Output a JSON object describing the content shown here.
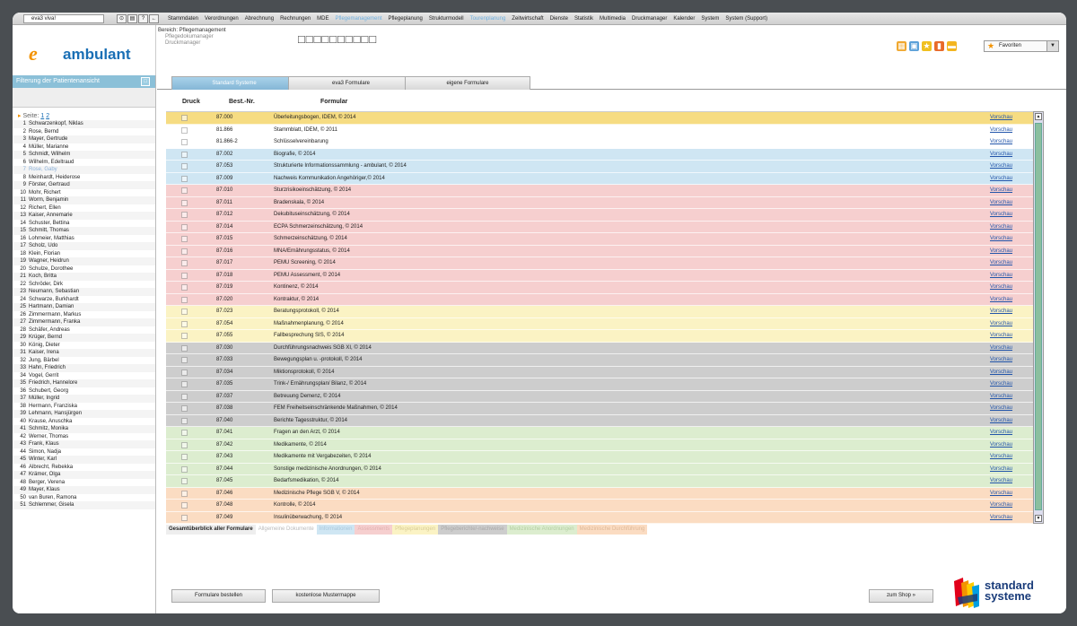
{
  "menubar": {
    "app_select": "eva3 viva!",
    "items": [
      "Stammdaten",
      "Verordnungen",
      "Abrechnung",
      "Rechnungen",
      "MDE",
      "Pflegemanagement",
      "Pflegeplanung",
      "Strukturmodell",
      "Tourenplanung",
      "Zeitwirtschaft",
      "Dienste",
      "Statistik",
      "Multimedia",
      "Druckmanager",
      "Kalender",
      "System",
      "System (Support)"
    ],
    "active_items": [
      5,
      8
    ]
  },
  "logo": {
    "mark": "e",
    "text": "ambulant"
  },
  "bereich": {
    "label": "Bereich: Pflegemanagement",
    "sub1": "Pflegedokumanager",
    "sub2": "Druckmanager"
  },
  "patient_placeholder": "□□□□□□□□□□",
  "favorites": {
    "label": "Favoriten"
  },
  "sidebar": {
    "filter_title": "Filterung der Patientenansicht",
    "seite_label": "Seite:",
    "pages": [
      "1",
      "2"
    ],
    "patients": [
      "Schwarzenkopf, Niklas",
      "Rose, Bernd",
      "Mayer, Gertrude",
      "Müller, Marianne",
      "Schmidt, Wilhelm",
      "Wilhelm, Edeltraud",
      "Rose, Gaby",
      "Meinhardt, Heiderose",
      "Förster, Gertraud",
      "Mohr, Richert",
      "Worm, Benjamin",
      "Richert, Ellen",
      "Kaiser, Annemarie",
      "Schuster, Bettina",
      "Schmitt, Thomas",
      "Lohmeier, Matthias",
      "Scholz, Udo",
      "Klein, Florian",
      "Wagner, Heidrun",
      "Schulze, Dorothee",
      "Koch, Britta",
      "Schröder, Dirk",
      "Neumann, Sebastian",
      "Schwarze, Burkhardt",
      "Hartmann, Damian",
      "Zimmermann, Markus",
      "Zimmermann, Franka",
      "Schäfer, Andreas",
      "Krüger, Bernd",
      "König, Dieter",
      "Kaiser, Irena",
      "Jung, Bärbel",
      "Hahn, Friedrich",
      "Vogel, Gerrit",
      "Friedrich, Hannelore",
      "Schubert, Georg",
      "Müller, Ingrid",
      "Hermann, Franziska",
      "Lehmann, Hansjürgen",
      "Krause, Anuschka",
      "Schmitz, Monika",
      "Werner, Thomas",
      "Frank, Klaus",
      "Simon, Nadja",
      "Winter, Karl",
      "Albrecht, Rebekka",
      "Krämer, Olga",
      "Berger, Verena",
      "Mayer, Klaus",
      "van Buren, Ramona",
      "Schlemmer, Gisela"
    ],
    "selected_index": 6
  },
  "tabs": [
    "Standard Systeme",
    "eva3 Formulare",
    "eigene Formulare"
  ],
  "table": {
    "headers": {
      "druck": "Druck",
      "nr": "Best.-Nr.",
      "formular": "Formular"
    },
    "link_label": "Vorschau",
    "rows": [
      {
        "nr": "87.000",
        "title": "Überleitungsbogen, IDEM, © 2014",
        "color": "#f6dc82"
      },
      {
        "nr": "81.866",
        "title": "Stammblatt, IDEM, © 2011",
        "color": "#ffffff"
      },
      {
        "nr": "81.866-2",
        "title": "Schlüsselvereinbarung",
        "color": "#ffffff"
      },
      {
        "nr": "87.002",
        "title": "Biografie, © 2014",
        "color": "#cfe6f3"
      },
      {
        "nr": "87.053",
        "title": "Strukturierte Informationssammlung - ambulant, © 2014",
        "color": "#cfe6f3"
      },
      {
        "nr": "87.009",
        "title": "Nachweis Kommunikation Angehöriger,© 2014",
        "color": "#cfe6f3"
      },
      {
        "nr": "87.010",
        "title": "Sturzrisikoeinschätzung, © 2014",
        "color": "#f6cfcf"
      },
      {
        "nr": "87.011",
        "title": "Bradenskala, © 2014",
        "color": "#f6cfcf"
      },
      {
        "nr": "87.012",
        "title": "Dekubituseinschätzung, © 2014",
        "color": "#f6cfcf"
      },
      {
        "nr": "87.014",
        "title": "ECPA Schmerzeinschätzung, © 2014",
        "color": "#f6cfcf"
      },
      {
        "nr": "87.015",
        "title": "Schmerzeinschätzung, © 2014",
        "color": "#f6cfcf"
      },
      {
        "nr": "87.016",
        "title": "MNA/Ernährungsstatus, © 2014",
        "color": "#f6cfcf"
      },
      {
        "nr": "87.017",
        "title": "PEMU Screening, © 2014",
        "color": "#f6cfcf"
      },
      {
        "nr": "87.018",
        "title": "PEMU Assessment, © 2014",
        "color": "#f6cfcf"
      },
      {
        "nr": "87.019",
        "title": "Kontinenz, © 2014",
        "color": "#f6cfcf"
      },
      {
        "nr": "87.020",
        "title": "Kontraktur, © 2014",
        "color": "#f6cfcf"
      },
      {
        "nr": "87.023",
        "title": "Beratungsprotokoll, © 2014",
        "color": "#fbf3c4"
      },
      {
        "nr": "87.054",
        "title": "Maßnahmenplanung, © 2014",
        "color": "#fbf3c4"
      },
      {
        "nr": "87.055",
        "title": "Fallbesprechung SIS, © 2014",
        "color": "#fbf3c4"
      },
      {
        "nr": "87.030",
        "title": "Durchführungsnachweis SGB XI, © 2014",
        "color": "#cdcdcd"
      },
      {
        "nr": "87.033",
        "title": "Bewegungsplan u. -protokoll, © 2014",
        "color": "#cdcdcd"
      },
      {
        "nr": "87.034",
        "title": "Miktionsprotokoll, © 2014",
        "color": "#cdcdcd"
      },
      {
        "nr": "87.035",
        "title": "Trink-/ Ernährungsplan/ Bilanz, © 2014",
        "color": "#cdcdcd"
      },
      {
        "nr": "87.037",
        "title": "Betreuung Demenz, © 2014",
        "color": "#cdcdcd"
      },
      {
        "nr": "87.038",
        "title": "FEM Freiheitseinschränkende Maßnahmen, © 2014",
        "color": "#cdcdcd"
      },
      {
        "nr": "87.040",
        "title": "Berichte Tagesstruktur, © 2014",
        "color": "#cdcdcd"
      },
      {
        "nr": "87.041",
        "title": "Fragen an den Arzt, © 2014",
        "color": "#dcedcf"
      },
      {
        "nr": "87.042",
        "title": "Medikamente, © 2014",
        "color": "#dcedcf"
      },
      {
        "nr": "87.043",
        "title": "Medikamente mit Vergabezeiten, © 2014",
        "color": "#dcedcf"
      },
      {
        "nr": "87.044",
        "title": "Sonstige medizinische Anordnungen, © 2014",
        "color": "#dcedcf"
      },
      {
        "nr": "87.045",
        "title": "Bedarfsmedikation, © 2014",
        "color": "#dcedcf"
      },
      {
        "nr": "87.046",
        "title": "Medizinische Pflege SGB V, © 2014",
        "color": "#fbdcc2"
      },
      {
        "nr": "87.048",
        "title": "Kontrolle, © 2014",
        "color": "#fbdcc2"
      },
      {
        "nr": "87.049",
        "title": "Insulinüberwachung, © 2014",
        "color": "#fbdcc2"
      }
    ]
  },
  "legend": [
    {
      "label": "Gesamtüberblick aller Formulare",
      "bg": "#eeeeee",
      "fg": "#222222"
    },
    {
      "label": "Allgemeine Dokumente",
      "bg": "#ffffff",
      "fg": "#bbbbbb"
    },
    {
      "label": "Informationen",
      "bg": "#cfe6f3",
      "fg": "#aac8dc"
    },
    {
      "label": "Assessments",
      "bg": "#f6cfcf",
      "fg": "#e0b0b0"
    },
    {
      "label": "Pflegeplanungen",
      "bg": "#fbf3c4",
      "fg": "#d8cc96"
    },
    {
      "label": "Pflegeberichte/-nachweise",
      "bg": "#cdcdcd",
      "fg": "#a8a8a8"
    },
    {
      "label": "Medizinische Anordnungen",
      "bg": "#dcedcf",
      "fg": "#b3cfa2"
    },
    {
      "label": "Medizinische Durchführung",
      "bg": "#fbdcc2",
      "fg": "#ddb898"
    }
  ],
  "buttons": {
    "order": "Formulare bestellen",
    "sample": "kostenlose Mustermappe",
    "shop": "zum Shop »"
  },
  "brand": {
    "line1": "standard",
    "line2": "systeme"
  }
}
